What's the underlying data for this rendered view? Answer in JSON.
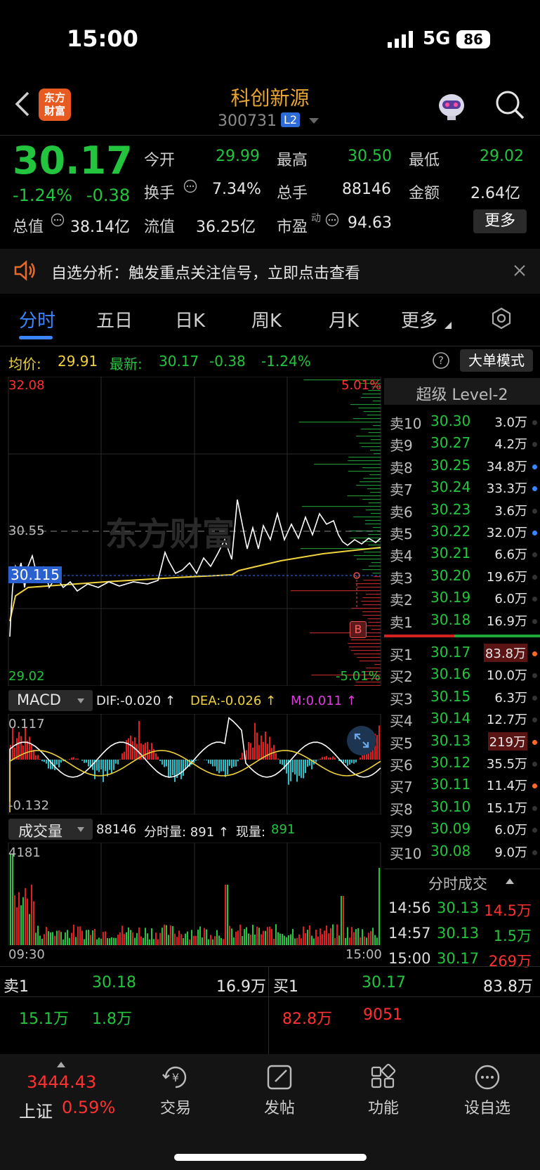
{
  "status_bar": {
    "time": "15:00",
    "network": "5G",
    "battery": "86"
  },
  "header": {
    "logo_line1": "东方",
    "logo_line2": "财富",
    "title": "科创新源",
    "code": "300731",
    "badge": "L2"
  },
  "quote": {
    "price": "30.17",
    "change_pct": "-1.24%",
    "change": "-0.38",
    "open_label": "今开",
    "open": "29.99",
    "high_label": "最高",
    "high": "30.50",
    "low_label": "最低",
    "low": "29.02",
    "turnover_label": "换手",
    "turnover": "7.34%",
    "volume_label": "总手",
    "volume": "88146",
    "amount_label": "金额",
    "amount": "2.64亿",
    "mktcap_label": "总值",
    "mktcap": "38.14亿",
    "float_label": "流值",
    "float": "36.25亿",
    "pe_label": "市盈",
    "pe_sup": "动",
    "pe": "94.63",
    "more_button": "更多"
  },
  "banner": {
    "text": "自选分析：触发重点关注信号，立即点击查看"
  },
  "tabs": [
    "分时",
    "五日",
    "日K",
    "周K",
    "月K",
    "更多"
  ],
  "chart_header": {
    "avg_label": "均价:",
    "avg": "29.91",
    "latest_label": "最新:",
    "latest": "30.17",
    "latest_change": "-0.38",
    "latest_pct": "-1.24%",
    "mode_button": "大单模式"
  },
  "chart_labels": {
    "top_price": "32.08",
    "top_pct": "5.01%",
    "mid_price": "30.55",
    "cursor_price": "30.115",
    "bottom_price": "29.02",
    "bottom_pct": "-5.01%",
    "marker": "B",
    "watermark": "东方财富"
  },
  "macd": {
    "selector": "MACD",
    "dif": "DIF:-0.020 ↑",
    "dea": "DEA:-0.026 ↑",
    "m": "M:0.011 ↑",
    "top": "0.117",
    "bottom": "-0.132"
  },
  "volume_panel": {
    "selector": "成交量",
    "total": "88146",
    "tick_label": "分时量: 891 ↑",
    "now_label": "现量:",
    "now": "891",
    "max": "4181",
    "time_start": "09:30",
    "time_end": "15:00"
  },
  "level2_title": "超级 Level-2",
  "asks": [
    {
      "label": "卖10",
      "price": "30.30",
      "vol": "3.0万"
    },
    {
      "label": "卖9",
      "price": "30.27",
      "vol": "4.2万"
    },
    {
      "label": "卖8",
      "price": "30.25",
      "vol": "34.8万"
    },
    {
      "label": "卖7",
      "price": "30.24",
      "vol": "33.3万"
    },
    {
      "label": "卖6",
      "price": "30.23",
      "vol": "3.6万"
    },
    {
      "label": "卖5",
      "price": "30.22",
      "vol": "32.0万"
    },
    {
      "label": "卖4",
      "price": "30.21",
      "vol": "6.6万"
    },
    {
      "label": "卖3",
      "price": "30.20",
      "vol": "19.6万"
    },
    {
      "label": "卖2",
      "price": "30.19",
      "vol": "6.0万"
    },
    {
      "label": "卖1",
      "price": "30.18",
      "vol": "16.9万"
    }
  ],
  "bids": [
    {
      "label": "买1",
      "price": "30.17",
      "vol": "83.8万"
    },
    {
      "label": "买2",
      "price": "30.16",
      "vol": "10.0万"
    },
    {
      "label": "买3",
      "price": "30.15",
      "vol": "6.3万"
    },
    {
      "label": "买4",
      "price": "30.14",
      "vol": "12.7万"
    },
    {
      "label": "买5",
      "price": "30.13",
      "vol": "219万"
    },
    {
      "label": "买6",
      "price": "30.12",
      "vol": "35.5万"
    },
    {
      "label": "买7",
      "price": "30.11",
      "vol": "11.4万"
    },
    {
      "label": "买8",
      "price": "30.10",
      "vol": "15.1万"
    },
    {
      "label": "买9",
      "price": "30.09",
      "vol": "6.0万"
    },
    {
      "label": "买10",
      "price": "30.08",
      "vol": "9.0万"
    }
  ],
  "ticks_title": "分时成交",
  "ticks": [
    {
      "time": "14:56",
      "price": "30.13",
      "vol": "14.5万"
    },
    {
      "time": "14:57",
      "price": "30.13",
      "vol": "1.5万"
    },
    {
      "time": "15:00",
      "price": "30.17",
      "vol": "269万"
    }
  ],
  "bottom_book": {
    "sell_label": "卖1",
    "sell_price": "30.18",
    "sell_vol": "16.9万",
    "sell_sub1": "15.1万",
    "sell_sub2": "1.8万",
    "buy_label": "买1",
    "buy_price": "30.17",
    "buy_vol": "83.8万",
    "buy_sub1": "82.8万",
    "buy_sub2": "9051"
  },
  "index": {
    "value": "3444.43",
    "name": "上证",
    "pct": "0.59%"
  },
  "nav": [
    "交易",
    "发帖",
    "功能",
    "设自选"
  ],
  "colors": {
    "up": "#ff3030",
    "down": "#23c43e",
    "accent": "#3b86ff",
    "avg_line": "#f0d23c"
  },
  "icons": [
    "back-icon",
    "robot-avatar-icon",
    "search-icon",
    "speaker-icon",
    "close-icon",
    "settings-icon",
    "help-icon",
    "expand-icon",
    "trade-icon",
    "post-icon",
    "apps-icon",
    "more-dots-icon"
  ]
}
